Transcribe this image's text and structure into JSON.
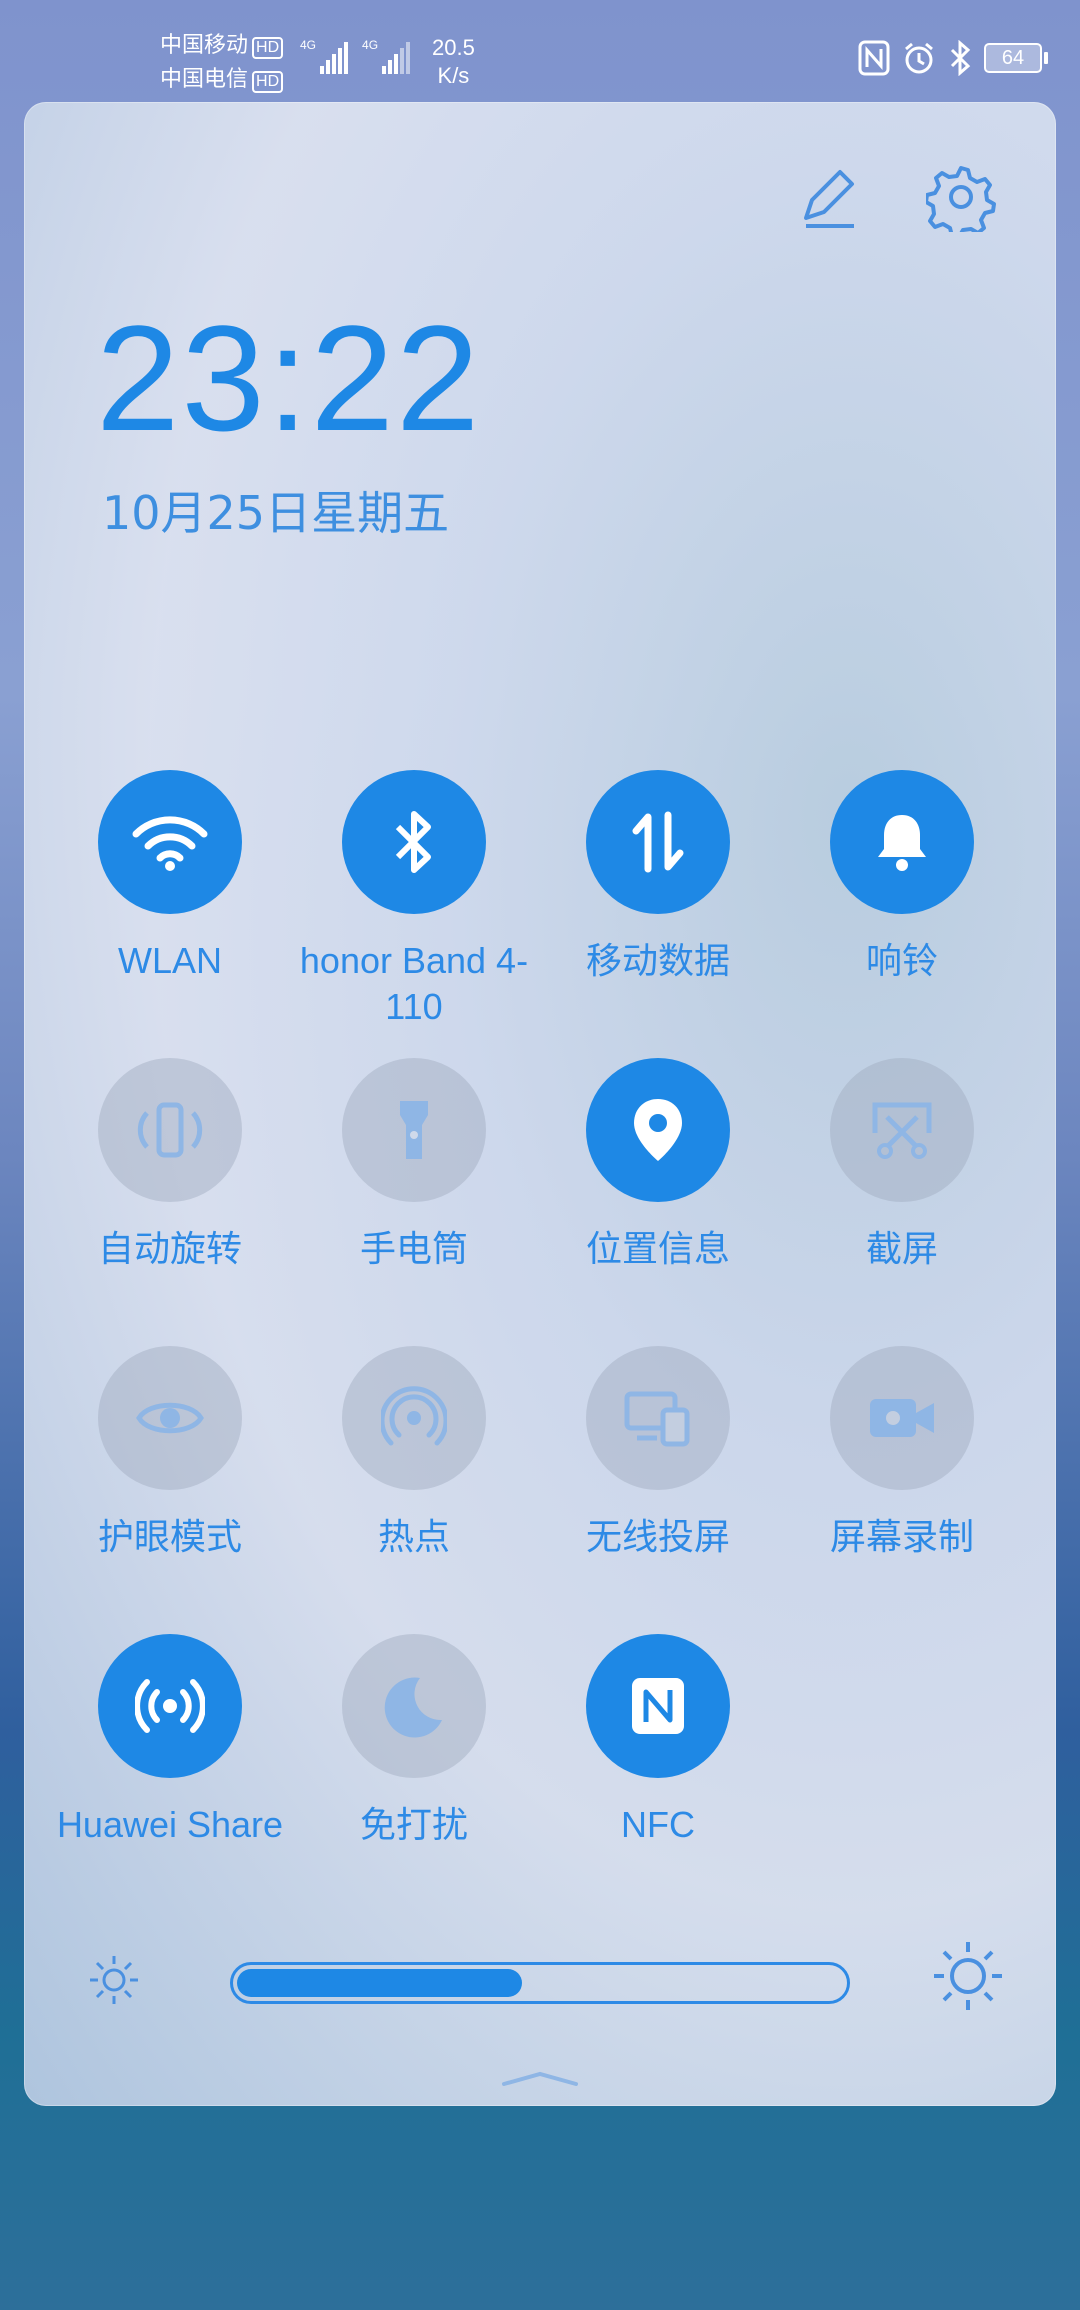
{
  "status_bar": {
    "carrier1": "中国移动",
    "carrier2": "中国电信",
    "hd_label": "HD",
    "network1": "4G",
    "network2": "4G",
    "speed_value": "20.5",
    "speed_unit": "K/s",
    "battery": "64",
    "icons": [
      "nfc-icon",
      "alarm-icon",
      "bluetooth-icon",
      "battery-icon"
    ]
  },
  "panel": {
    "time": "23:22",
    "date": "10月25日星期五",
    "edit_icon": "pencil-icon",
    "settings_icon": "gear-icon"
  },
  "tiles": [
    {
      "label": "WLAN",
      "icon": "wifi-icon",
      "on": true
    },
    {
      "label": "honor Band 4-110",
      "icon": "bluetooth-icon",
      "on": true
    },
    {
      "label": "移动数据",
      "icon": "mobile-data-icon",
      "on": true
    },
    {
      "label": "响铃",
      "icon": "bell-icon",
      "on": true
    },
    {
      "label": "自动旋转",
      "icon": "auto-rotate-icon",
      "on": false
    },
    {
      "label": "手电筒",
      "icon": "flashlight-icon",
      "on": false
    },
    {
      "label": "位置信息",
      "icon": "location-pin-icon",
      "on": true
    },
    {
      "label": "截屏",
      "icon": "screenshot-icon",
      "on": false
    },
    {
      "label": "护眼模式",
      "icon": "eye-icon",
      "on": false
    },
    {
      "label": "热点",
      "icon": "hotspot-icon",
      "on": false
    },
    {
      "label": "无线投屏",
      "icon": "wireless-projection-icon",
      "on": false
    },
    {
      "label": "屏幕录制",
      "icon": "screen-record-icon",
      "on": false
    },
    {
      "label": "Huawei Share",
      "icon": "huawei-share-icon",
      "on": true
    },
    {
      "label": "免打扰",
      "icon": "moon-icon",
      "on": false
    },
    {
      "label": "NFC",
      "icon": "nfc-icon",
      "on": true
    }
  ],
  "brightness": {
    "level": 0.47,
    "accent": "#1e88e5"
  },
  "colors": {
    "accent": "#1e88e5",
    "label": "#2d8ae6"
  }
}
